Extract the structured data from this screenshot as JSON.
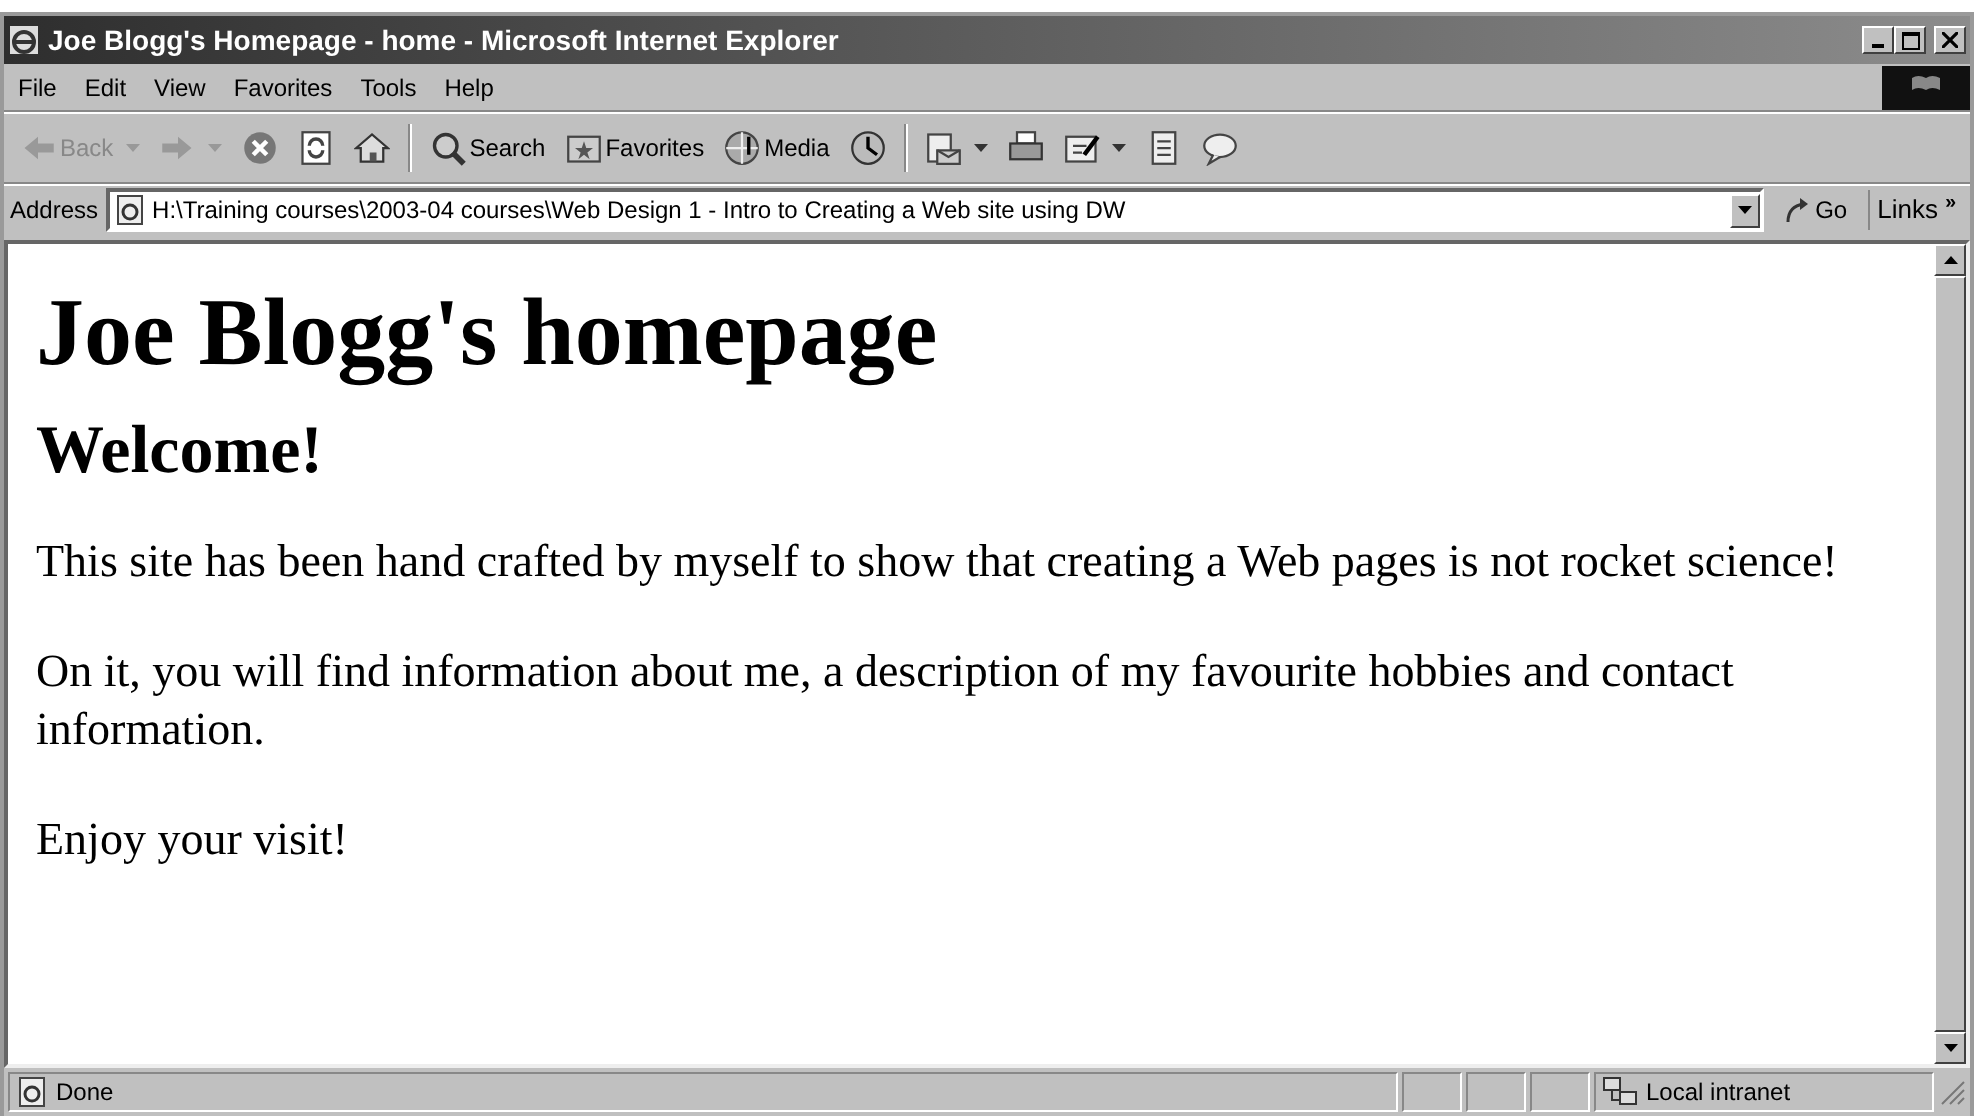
{
  "window": {
    "title": "Joe Blogg's Homepage - home - Microsoft Internet Explorer"
  },
  "menu": [
    "File",
    "Edit",
    "View",
    "Favorites",
    "Tools",
    "Help"
  ],
  "toolbar": [
    {
      "kind": "back",
      "label": "Back",
      "disabled": true,
      "dropdown": true
    },
    {
      "kind": "forward",
      "disabled": true,
      "dropdown": true
    },
    {
      "kind": "stop"
    },
    {
      "kind": "refresh"
    },
    {
      "kind": "home"
    },
    {
      "kind": "separator"
    },
    {
      "kind": "search",
      "label": "Search"
    },
    {
      "kind": "favorites",
      "label": "Favorites"
    },
    {
      "kind": "media",
      "label": "Media"
    },
    {
      "kind": "history"
    },
    {
      "kind": "separator"
    },
    {
      "kind": "mail",
      "dropdown": true
    },
    {
      "kind": "print"
    },
    {
      "kind": "edit",
      "dropdown": true
    },
    {
      "kind": "document"
    },
    {
      "kind": "discuss"
    }
  ],
  "address": {
    "label": "Address",
    "value": "H:\\Training courses\\2003-04 courses\\Web Design 1 - Intro to Creating a Web site using DW",
    "go": "Go",
    "links": "Links",
    "chevron": "»"
  },
  "page": {
    "heading": "Joe Blogg's homepage",
    "subheading": "Welcome!",
    "paragraphs": [
      "This site has been hand crafted by myself to show that creating a Web pages is not rocket science!",
      "On it, you will find information about me, a description of my favourite hobbies and contact information.",
      "Enjoy your visit!"
    ]
  },
  "status_bar": {
    "text": "Done",
    "zone": "Local intranet"
  }
}
